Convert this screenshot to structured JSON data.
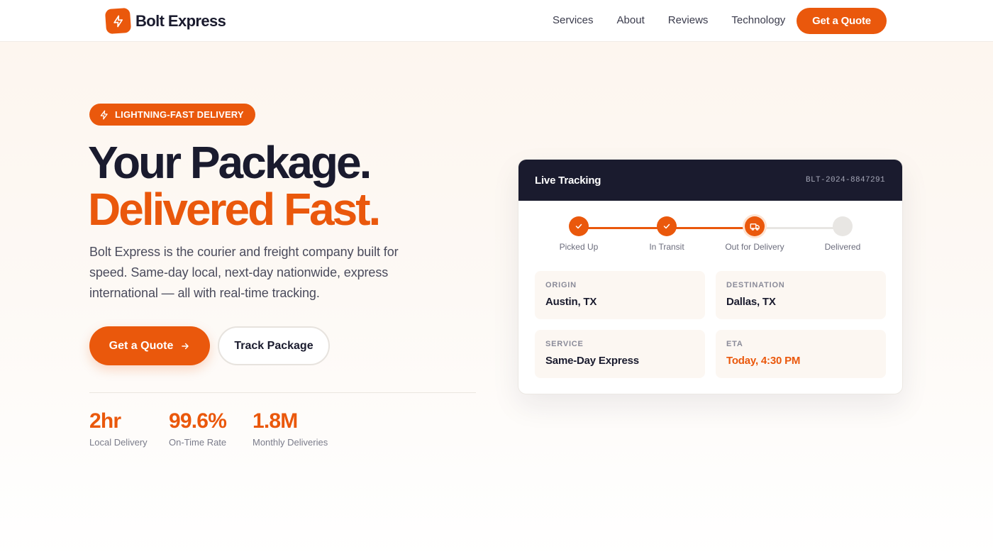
{
  "brand": {
    "name": "Bolt Express",
    "logo_icon": "lightning-bolt-icon",
    "accent": "#ea580c",
    "dark": "#1a1b2e"
  },
  "nav": {
    "links": [
      "Services",
      "About",
      "Reviews",
      "Technology"
    ],
    "cta": "Get a Quote"
  },
  "hero": {
    "badge": "LIGHTNING-FAST DELIVERY",
    "headline_line1": "Your Package.",
    "headline_line2": "Delivered Fast.",
    "lead": "Bolt Express is the courier and freight company built for speed. Same-day local, next-day nationwide, express international — all with real-time tracking.",
    "primary_button": "Get a Quote",
    "secondary_button": "Track Package",
    "stats": [
      {
        "value": "2hr",
        "label": "Local Delivery"
      },
      {
        "value": "99.6%",
        "label": "On-Time Rate"
      },
      {
        "value": "1.8M",
        "label": "Monthly Deliveries"
      }
    ]
  },
  "tracking": {
    "title": "Live Tracking",
    "tracking_id": "BLT-2024-8847291",
    "steps": [
      {
        "label": "Picked Up",
        "state": "done",
        "icon": "check-icon"
      },
      {
        "label": "In Transit",
        "state": "done",
        "icon": "check-icon"
      },
      {
        "label": "Out for Delivery",
        "state": "active",
        "icon": "truck-icon"
      },
      {
        "label": "Delivered",
        "state": "pending",
        "icon": ""
      }
    ],
    "details": [
      {
        "label": "ORIGIN",
        "value": "Austin, TX"
      },
      {
        "label": "DESTINATION",
        "value": "Dallas, TX"
      },
      {
        "label": "SERVICE",
        "value": "Same-Day Express"
      },
      {
        "label": "ETA",
        "value": "Today, 4:30 PM"
      }
    ]
  }
}
